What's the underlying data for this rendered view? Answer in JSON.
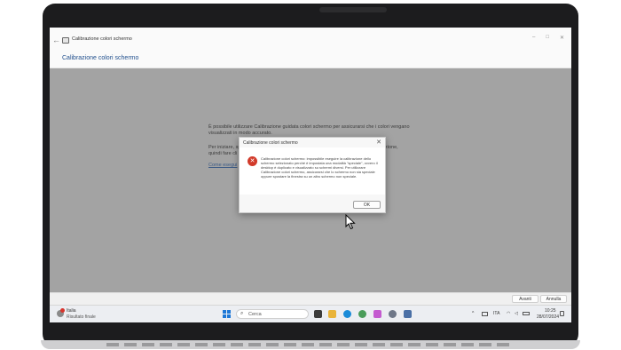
{
  "window": {
    "title": "Calibrazione colori schermo",
    "back": "←",
    "controls": [
      "–",
      "□",
      "✕"
    ]
  },
  "page": {
    "heading": "Calibrazione colori schermo",
    "para1_line1": "È possibile utilizzare Calibrazione guidata colori schermo per assicurarsi che i colori vengano",
    "para1_line2": "visualizzati in modo accurato.",
    "para2_left1": "Per iniziare, sp",
    "para2_left2": "quindi fare cli",
    "para2_right": "zione,",
    "link_partial": "Come esegui"
  },
  "footer": {
    "next_label": "Avanti",
    "cancel_label": "Annulla"
  },
  "dialog": {
    "title": "Calibrazione colori schermo",
    "close": "✕",
    "error_glyph": "✕",
    "message": "Calibrazione colori schermo: impossibile eseguire la calibrazione dello schermo selezionato perché è impostata una modalità \"speciale\", ovvero il desktop è duplicato e visualizzato su schermi diversi. Per utilizzare Calibrazione colori schermo, assicurarsi che lo schermo non sia speciale oppure spostare la finestra su un altro schermo non speciale.",
    "ok_label": "OK"
  },
  "taskbar": {
    "weather_title": "Italia",
    "weather_subtitle": "Risultato finale",
    "search_placeholder": "Cerca",
    "search_glyph": "⌕",
    "tray_chevron": "^",
    "tray_lang": "ITA",
    "time": "10:25",
    "date": "28/07/2024",
    "apps": [
      {
        "name": "task-view",
        "color": "#3b3b3b"
      },
      {
        "name": "file-explorer",
        "color": "#e9b43a"
      },
      {
        "name": "edge",
        "color": "#1a8bd8"
      },
      {
        "name": "copilot",
        "color": "#4a9c5a"
      },
      {
        "name": "ms-store",
        "color": "#c45bd0"
      },
      {
        "name": "settings",
        "color": "#6e7788"
      },
      {
        "name": "color-calibration",
        "color": "#4a6fa5"
      }
    ]
  },
  "colors": {
    "accent": "#1f4e8c",
    "error": "#d23a2a",
    "start": "#1e78d7"
  }
}
